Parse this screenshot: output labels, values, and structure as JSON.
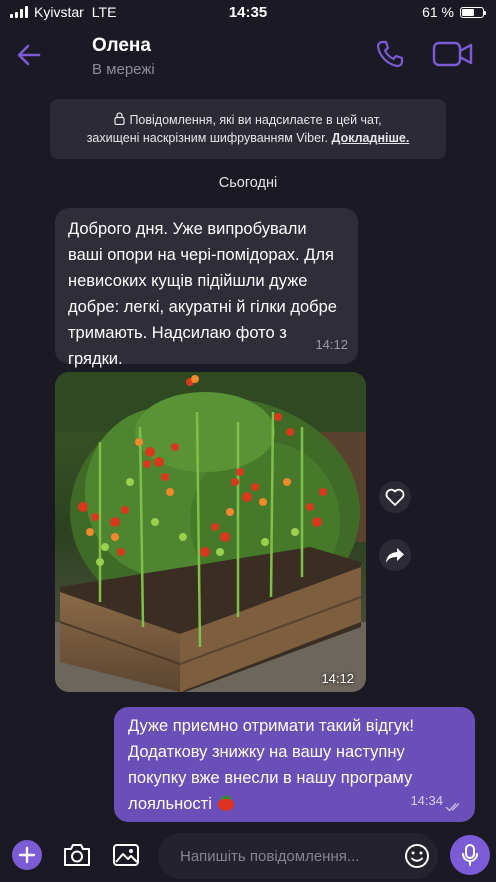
{
  "status_bar": {
    "carrier": "Kyivstar",
    "network": "LTE",
    "time": "14:35",
    "battery": "61 %",
    "battery_level": 0.61
  },
  "header": {
    "contact_name": "Олена",
    "contact_status": "В мережі",
    "icons": [
      "back-arrow-icon",
      "phone-icon",
      "video-camera-icon"
    ],
    "accent_color": "#7b5cd6"
  },
  "encryption_banner": {
    "line1": "Повідомлення, які ви надсилаєте в цей чат,",
    "line2": "захищені наскрізним шифруванням Viber.",
    "link": "Докладніше."
  },
  "date_separator": "Сьогодні",
  "messages": [
    {
      "direction": "incoming",
      "lines": [
        "Доброго дня. Уже випробували",
        "ваші опори на черi-помідорах. Для",
        "невисоких кущів підійшли дуже",
        "добре: легкі, акуратні й гілки добре",
        "тримають. Надсилаю фото з грядки."
      ],
      "time": "14:12"
    },
    {
      "direction": "incoming",
      "type": "photo",
      "time": "14:12",
      "side_icons": [
        "heart-icon",
        "share-icon"
      ]
    },
    {
      "direction": "outgoing",
      "lines": [
        "Дуже приємно отримати такий відгук!",
        "Додаткову знижку на вашу наступну",
        "покупку вже внесли в нашу програму",
        "лояльності"
      ],
      "emoji": "tomato",
      "time": "14:34",
      "status": "read"
    }
  ],
  "composer": {
    "placeholder": "Напишіть повідомлення...",
    "icons": [
      "plus-icon",
      "camera-icon",
      "gallery-icon",
      "emoji-icon",
      "microphone-icon"
    ]
  }
}
